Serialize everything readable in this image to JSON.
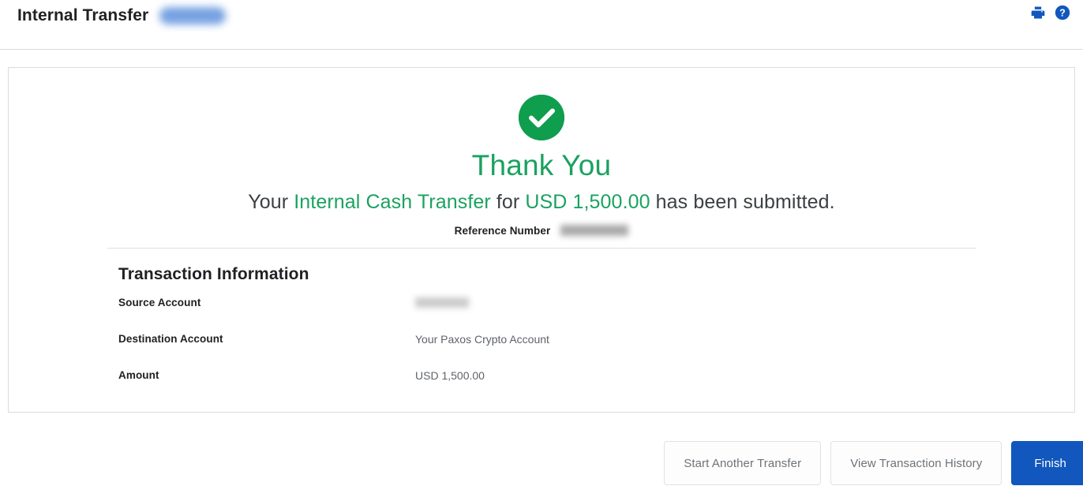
{
  "header": {
    "title": "Internal Transfer",
    "badge_redacted": true,
    "icons": [
      {
        "name": "print-icon",
        "label": "Print"
      },
      {
        "name": "help-icon",
        "label": "Help"
      }
    ]
  },
  "success": {
    "status_icon": "check-circle-icon",
    "heading": "Thank You",
    "message_prefix": "Your ",
    "message_type": "Internal Cash Transfer",
    "message_middle": " for ",
    "message_amount": "USD 1,500.00",
    "message_suffix": " has been submitted.",
    "reference_label": "Reference Number",
    "reference_value_redacted": true
  },
  "transaction": {
    "section_title": "Transaction Information",
    "rows": [
      {
        "label": "Source Account",
        "value": "",
        "redacted": true
      },
      {
        "label": "Destination Account",
        "value": "Your Paxos Crypto Account",
        "redacted": false
      },
      {
        "label": "Amount",
        "value": "USD 1,500.00",
        "redacted": false
      }
    ]
  },
  "footer": {
    "start_another_label": "Start Another Transfer",
    "view_history_label": "View Transaction History",
    "finish_label": "Finish"
  },
  "colors": {
    "success_green": "#0f9d4e",
    "heading_green": "#1aa260",
    "primary_blue": "#1257bd",
    "icon_blue": "#1257bd",
    "border_gray": "#dcdcdc"
  }
}
